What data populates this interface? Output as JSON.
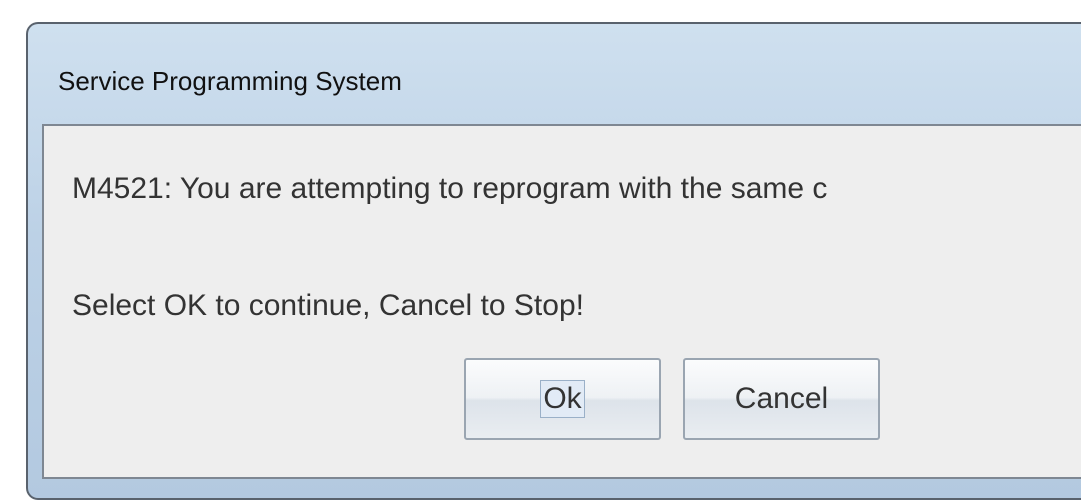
{
  "dialog": {
    "title": "Service Programming System",
    "message": "M4521: You are attempting to reprogram with the same c",
    "instruction": "Select OK to continue, Cancel to Stop!",
    "buttons": {
      "ok_label": "Ok",
      "cancel_label": "Cancel"
    }
  },
  "colors": {
    "titlebar": "#bcd1e6",
    "client_background": "#eeeeee",
    "text": "#333333",
    "window_border": "#59626d"
  }
}
